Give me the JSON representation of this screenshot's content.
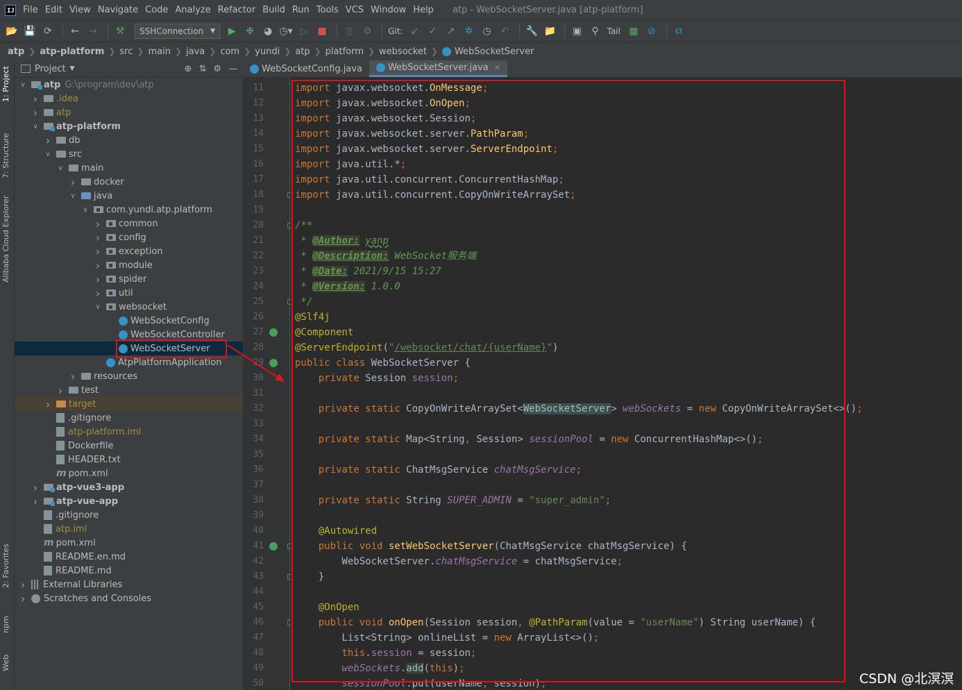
{
  "menu": {
    "items": [
      "File",
      "Edit",
      "View",
      "Navigate",
      "Code",
      "Analyze",
      "Refactor",
      "Build",
      "Run",
      "Tools",
      "VCS",
      "Window",
      "Help"
    ],
    "window_title": "atp - WebSocketServer.java [atp-platform]"
  },
  "toolbar": {
    "run_config": "SSHConnection",
    "git_label": "Git:",
    "tail_label": "Tail"
  },
  "breadcrumb": [
    "atp",
    "atp-platform",
    "src",
    "main",
    "java",
    "com",
    "yundi",
    "atp",
    "platform",
    "websocket",
    "WebSocketServer"
  ],
  "left_strip": {
    "project": "1: Project",
    "structure": "7: Structure",
    "alibaba": "Alibaba Cloud Explorer",
    "favorites": "2: Favorites",
    "npm": "npm",
    "web": "Web"
  },
  "project_panel": {
    "title": "Project",
    "tree": [
      {
        "label": "atp",
        "path": "G:\\program\\dev\\atp",
        "depth": 0,
        "toggle": "open",
        "icon": "module",
        "bold": true
      },
      {
        "label": ".idea",
        "depth": 1,
        "toggle": "closed",
        "icon": "folder",
        "color": "yellow"
      },
      {
        "label": "atp",
        "depth": 1,
        "toggle": "closed",
        "icon": "folder",
        "color": "yellow"
      },
      {
        "label": "atp-platform",
        "depth": 1,
        "toggle": "open",
        "icon": "module",
        "bold": true
      },
      {
        "label": "db",
        "depth": 2,
        "toggle": "closed",
        "icon": "folder"
      },
      {
        "label": "src",
        "depth": 2,
        "toggle": "open",
        "icon": "folder"
      },
      {
        "label": "main",
        "depth": 3,
        "toggle": "open",
        "icon": "folder"
      },
      {
        "label": "docker",
        "depth": 4,
        "toggle": "closed",
        "icon": "folder"
      },
      {
        "label": "java",
        "depth": 4,
        "toggle": "open",
        "icon": "folder-src"
      },
      {
        "label": "com.yundi.atp.platform",
        "depth": 5,
        "toggle": "open",
        "icon": "package"
      },
      {
        "label": "common",
        "depth": 6,
        "toggle": "closed",
        "icon": "package"
      },
      {
        "label": "config",
        "depth": 6,
        "toggle": "closed",
        "icon": "package"
      },
      {
        "label": "exception",
        "depth": 6,
        "toggle": "closed",
        "icon": "package"
      },
      {
        "label": "module",
        "depth": 6,
        "toggle": "closed",
        "icon": "package"
      },
      {
        "label": "spider",
        "depth": 6,
        "toggle": "closed",
        "icon": "package"
      },
      {
        "label": "util",
        "depth": 6,
        "toggle": "closed",
        "icon": "package"
      },
      {
        "label": "websocket",
        "depth": 6,
        "toggle": "open",
        "icon": "package"
      },
      {
        "label": "WebSocketConfig",
        "depth": 7,
        "toggle": "none",
        "icon": "class"
      },
      {
        "label": "WebSocketController",
        "depth": 7,
        "toggle": "none",
        "icon": "class"
      },
      {
        "label": "WebSocketServer",
        "depth": 7,
        "toggle": "none",
        "icon": "class",
        "selected": true
      },
      {
        "label": "AtpPlatformApplication",
        "depth": 6,
        "toggle": "none",
        "icon": "class"
      },
      {
        "label": "resources",
        "depth": 4,
        "toggle": "closed",
        "icon": "folder"
      },
      {
        "label": "test",
        "depth": 3,
        "toggle": "closed",
        "icon": "folder"
      },
      {
        "label": "target",
        "depth": 2,
        "toggle": "closed",
        "icon": "folder-excluded",
        "color": "yellow",
        "excluded": true
      },
      {
        "label": ".gitignore",
        "depth": 2,
        "toggle": "none",
        "icon": "file"
      },
      {
        "label": "atp-platform.iml",
        "depth": 2,
        "toggle": "none",
        "icon": "file",
        "color": "yellow"
      },
      {
        "label": "Dockerfile",
        "depth": 2,
        "toggle": "none",
        "icon": "file"
      },
      {
        "label": "HEADER.txt",
        "depth": 2,
        "toggle": "none",
        "icon": "file"
      },
      {
        "label": "pom.xml",
        "depth": 2,
        "toggle": "none",
        "icon": "maven"
      },
      {
        "label": "atp-vue3-app",
        "depth": 1,
        "toggle": "closed",
        "icon": "module",
        "bold": true
      },
      {
        "label": "atp-vue-app",
        "depth": 1,
        "toggle": "closed",
        "icon": "module",
        "bold": true
      },
      {
        "label": ".gitignore",
        "depth": 1,
        "toggle": "none",
        "icon": "file"
      },
      {
        "label": "atp.iml",
        "depth": 1,
        "toggle": "none",
        "icon": "file",
        "color": "yellow"
      },
      {
        "label": "pom.xml",
        "depth": 1,
        "toggle": "none",
        "icon": "maven"
      },
      {
        "label": "README.en.md",
        "depth": 1,
        "toggle": "none",
        "icon": "file"
      },
      {
        "label": "README.md",
        "depth": 1,
        "toggle": "none",
        "icon": "file"
      },
      {
        "label": "External Libraries",
        "depth": 0,
        "toggle": "closed",
        "icon": "library"
      },
      {
        "label": "Scratches and Consoles",
        "depth": 0,
        "toggle": "closed",
        "icon": "scratch"
      }
    ]
  },
  "editor": {
    "tabs": [
      {
        "label": "WebSocketConfig.java",
        "active": false
      },
      {
        "label": "WebSocketServer.java",
        "active": true
      }
    ],
    "first_line": 11,
    "gutter_icons": {
      "27": "bean",
      "29": "bean",
      "41": "bean"
    },
    "fold_lines": [
      18,
      20,
      25,
      41,
      43,
      46
    ],
    "lines": [
      [
        [
          "kw",
          "import"
        ],
        [
          "pn",
          " javax.websocket."
        ],
        [
          "mt",
          "OnMessage"
        ],
        [
          "kw",
          ";"
        ]
      ],
      [
        [
          "kw",
          "import"
        ],
        [
          "pn",
          " javax.websocket."
        ],
        [
          "mt",
          "OnOpen"
        ],
        [
          "kw",
          ";"
        ]
      ],
      [
        [
          "kw",
          "import"
        ],
        [
          "pn",
          " javax.websocket.Session"
        ],
        [
          "kw",
          ";"
        ]
      ],
      [
        [
          "kw",
          "import"
        ],
        [
          "pn",
          " javax.websocket.server."
        ],
        [
          "mt",
          "PathParam"
        ],
        [
          "kw",
          ";"
        ]
      ],
      [
        [
          "kw",
          "import"
        ],
        [
          "pn",
          " javax.websocket.server."
        ],
        [
          "mt",
          "ServerEndpoint"
        ],
        [
          "kw",
          ";"
        ]
      ],
      [
        [
          "kw",
          "import"
        ],
        [
          "pn",
          " java.util.*"
        ],
        [
          "kw",
          ";"
        ]
      ],
      [
        [
          "kw",
          "import"
        ],
        [
          "pn",
          " java.util.concurrent.ConcurrentHashMap"
        ],
        [
          "kw",
          ";"
        ]
      ],
      [
        [
          "kw",
          "import"
        ],
        [
          "pn",
          " java.util.concurrent.CopyOnWriteArraySet"
        ],
        [
          "kw",
          ";"
        ]
      ],
      [],
      [
        [
          "cm",
          "/**"
        ]
      ],
      [
        [
          "cm",
          " * "
        ],
        [
          "tagc",
          "@Author:"
        ],
        [
          "cm",
          " "
        ],
        [
          "cmu",
          "yanp"
        ]
      ],
      [
        [
          "cm",
          " * "
        ],
        [
          "tagc",
          "@Description:"
        ],
        [
          "cm",
          " WebSocket服务端"
        ]
      ],
      [
        [
          "cm",
          " * "
        ],
        [
          "tagc",
          "@Date:"
        ],
        [
          "cm",
          " 2021/9/15 15:27"
        ]
      ],
      [
        [
          "cm",
          " * "
        ],
        [
          "tagc",
          "@Version:"
        ],
        [
          "cm",
          " 1.0.0"
        ]
      ],
      [
        [
          "cm",
          " */"
        ]
      ],
      [
        [
          "an",
          "@Slf4j"
        ]
      ],
      [
        [
          "an",
          "@Component"
        ]
      ],
      [
        [
          "an",
          "@ServerEndpoint"
        ],
        [
          "pn",
          "("
        ],
        [
          "st",
          "\""
        ],
        [
          "sl",
          "/websocket/chat/{userName}"
        ],
        [
          "st",
          "\""
        ],
        [
          "pn",
          ")"
        ]
      ],
      [
        [
          "kw",
          "public class"
        ],
        [
          "pn",
          " WebSocketServer {"
        ]
      ],
      [
        [
          "pn",
          "    "
        ],
        [
          "kw",
          "private"
        ],
        [
          "pn",
          " Session "
        ],
        [
          "fd",
          "session"
        ],
        [
          "kw",
          ";"
        ]
      ],
      [],
      [
        [
          "pn",
          "    "
        ],
        [
          "kw",
          "private static"
        ],
        [
          "pn",
          " CopyOnWriteArraySet<"
        ],
        [
          "hlb",
          "WebSocketServer"
        ],
        [
          "pn",
          "> "
        ],
        [
          "sfi",
          "webSockets"
        ],
        [
          "pn",
          " = "
        ],
        [
          "kw",
          "new"
        ],
        [
          "pn",
          " CopyOnWriteArraySet<>()"
        ],
        [
          "kw",
          ";"
        ]
      ],
      [],
      [
        [
          "pn",
          "    "
        ],
        [
          "kw",
          "private static"
        ],
        [
          "pn",
          " Map<String"
        ],
        [
          "kw",
          ","
        ],
        [
          "pn",
          " Session> "
        ],
        [
          "sfi",
          "sessionPool"
        ],
        [
          "pn",
          " = "
        ],
        [
          "kw",
          "new"
        ],
        [
          "pn",
          " ConcurrentHashMap<>()"
        ],
        [
          "kw",
          ";"
        ]
      ],
      [],
      [
        [
          "pn",
          "    "
        ],
        [
          "kw",
          "private static"
        ],
        [
          "pn",
          " ChatMsgService "
        ],
        [
          "sfi",
          "chatMsgService"
        ],
        [
          "kw",
          ";"
        ]
      ],
      [],
      [
        [
          "pn",
          "    "
        ],
        [
          "kw",
          "private static"
        ],
        [
          "pn",
          " String "
        ],
        [
          "sfi",
          "SUPER_ADMIN"
        ],
        [
          "pn",
          " = "
        ],
        [
          "st",
          "\"super_admin\""
        ],
        [
          "kw",
          ";"
        ]
      ],
      [],
      [
        [
          "pn",
          "    "
        ],
        [
          "an",
          "@Autowired"
        ]
      ],
      [
        [
          "pn",
          "    "
        ],
        [
          "kw",
          "public void"
        ],
        [
          "pn",
          " "
        ],
        [
          "mt",
          "setWebSocketServer"
        ],
        [
          "pn",
          "(ChatMsgService chatMsgService) {"
        ]
      ],
      [
        [
          "pn",
          "        WebSocketServer."
        ],
        [
          "sfi",
          "chatMsgService"
        ],
        [
          "pn",
          " = chatMsgService"
        ],
        [
          "kw",
          ";"
        ]
      ],
      [
        [
          "pn",
          "    }"
        ]
      ],
      [],
      [
        [
          "pn",
          "    "
        ],
        [
          "an",
          "@OnOpen"
        ]
      ],
      [
        [
          "pn",
          "    "
        ],
        [
          "kw",
          "public void"
        ],
        [
          "pn",
          " "
        ],
        [
          "mt",
          "onOpen"
        ],
        [
          "pn",
          "(Session session"
        ],
        [
          "kw",
          ","
        ],
        [
          "pn",
          " "
        ],
        [
          "an",
          "@PathParam"
        ],
        [
          "pn",
          "(value = "
        ],
        [
          "st",
          "\"userName\""
        ],
        [
          "pn",
          ") String userName) {"
        ]
      ],
      [
        [
          "pn",
          "        List<String> onlineList = "
        ],
        [
          "kw",
          "new"
        ],
        [
          "pn",
          " ArrayList<>()"
        ],
        [
          "kw",
          ";"
        ]
      ],
      [
        [
          "pn",
          "        "
        ],
        [
          "kw",
          "this"
        ],
        [
          "pn",
          "."
        ],
        [
          "fd",
          "session"
        ],
        [
          "pn",
          " = session"
        ],
        [
          "kw",
          ";"
        ]
      ],
      [
        [
          "pn",
          "        "
        ],
        [
          "sfi",
          "webSockets"
        ],
        [
          "pn",
          "."
        ],
        [
          "hl",
          "add"
        ],
        [
          "pn",
          "("
        ],
        [
          "kw",
          "this"
        ],
        [
          "pn",
          ")"
        ],
        [
          "kw",
          ";"
        ]
      ],
      [
        [
          "pn",
          "        "
        ],
        [
          "sfi",
          "sessionPool"
        ],
        [
          "pn",
          ".put(userName"
        ],
        [
          "kw",
          ","
        ],
        [
          "pn",
          " session)"
        ],
        [
          "kw",
          ";"
        ]
      ]
    ]
  },
  "watermark": "CSDN @北溟溟",
  "colors": {
    "annotation_box": "#e0121a",
    "selection": "#0d293e",
    "accent": "#4a88c7"
  }
}
